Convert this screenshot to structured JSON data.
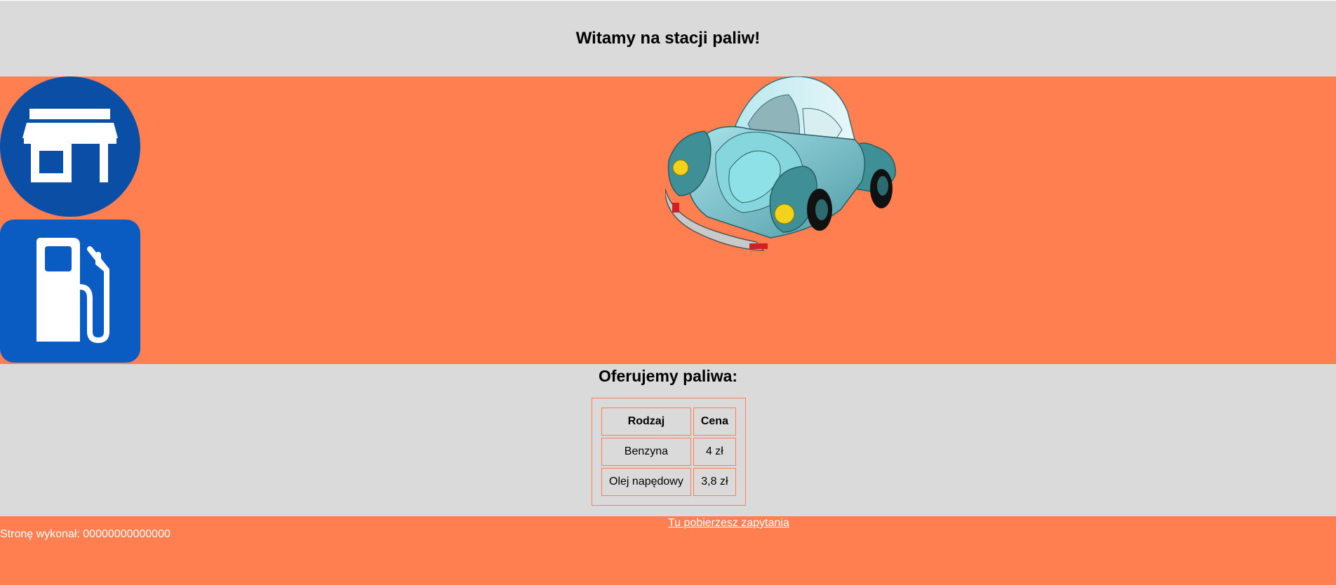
{
  "header": {
    "title": "Witamy na stacji paliw!"
  },
  "banner": {
    "icons": [
      "shop-icon",
      "fuel-pump-icon"
    ],
    "image": "car-illustration",
    "colors": {
      "background": "#ff7f50",
      "shop_icon_bg": "#0a4fa5",
      "fuel_icon_bg": "#0a5cc2"
    }
  },
  "offer": {
    "title": "Oferujemy paliwa:",
    "table": {
      "headers": [
        "Rodzaj",
        "Cena"
      ],
      "rows": [
        [
          "Benzyna",
          "4 zł"
        ],
        [
          "Olej napędowy",
          "3,8 zł"
        ]
      ]
    }
  },
  "footer": {
    "link_label": "Tu pobierzesz zapytania",
    "author": "Stronę wykonał: 00000000000000"
  },
  "colors": {
    "section_grey": "#dadada",
    "accent_coral": "#ff7f50"
  }
}
